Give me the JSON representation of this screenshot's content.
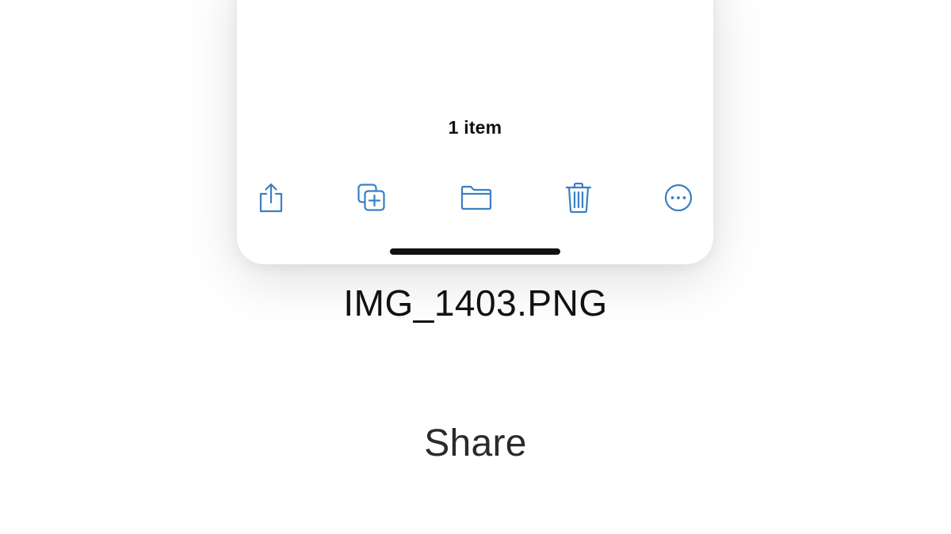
{
  "sheet": {
    "item_count": "1 item",
    "toolbar": {
      "accent_color": "#3a7fc4",
      "actions": [
        {
          "name": "share",
          "icon": "share-icon"
        },
        {
          "name": "duplicate",
          "icon": "duplicate-icon"
        },
        {
          "name": "move",
          "icon": "folder-icon"
        },
        {
          "name": "delete",
          "icon": "trash-icon"
        },
        {
          "name": "more",
          "icon": "more-icon"
        }
      ]
    }
  },
  "file_name": "IMG_1403.PNG",
  "caption": "Share"
}
